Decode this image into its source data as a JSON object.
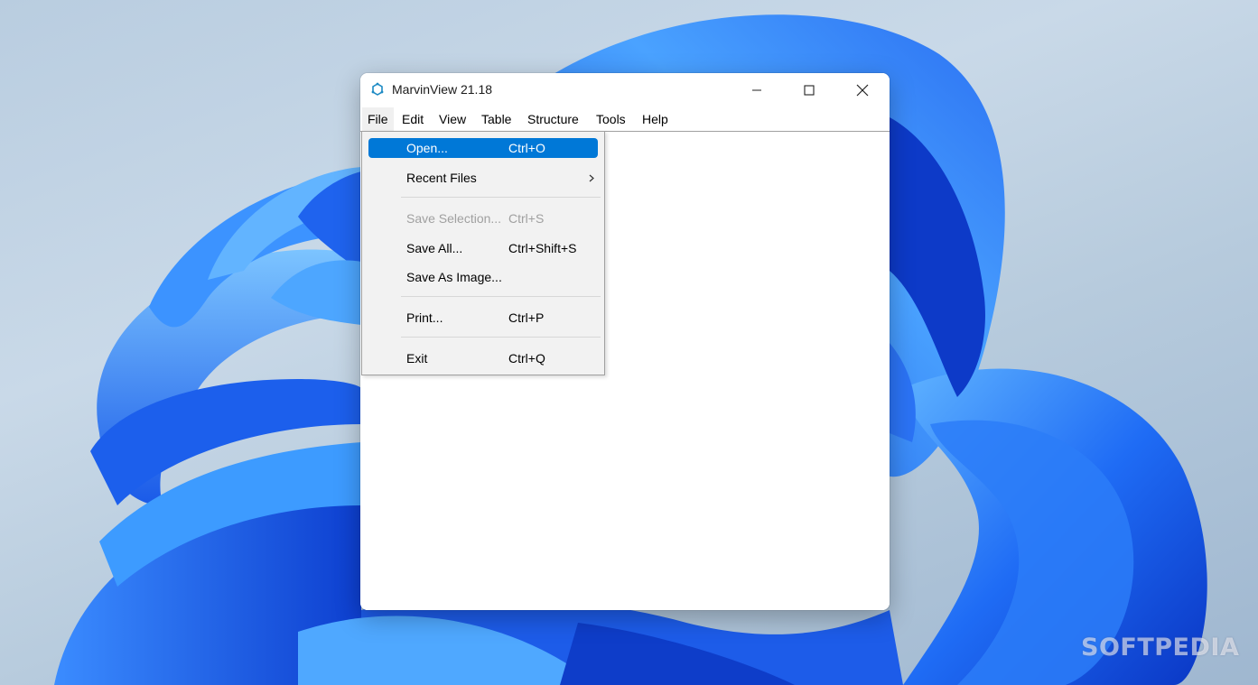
{
  "window": {
    "title": "MarvinView 21.18"
  },
  "menubar": {
    "items": [
      "File",
      "Edit",
      "View",
      "Table",
      "Structure",
      "Tools",
      "Help"
    ]
  },
  "file_menu": {
    "items": [
      {
        "label": "Open...",
        "shortcut": "Ctrl+O",
        "highlighted": true,
        "enabled": true
      },
      {
        "label": "Recent Files",
        "shortcut": "",
        "submenu": true,
        "enabled": true
      },
      {
        "label": "Save Selection...",
        "shortcut": "Ctrl+S",
        "enabled": false
      },
      {
        "label": "Save All...",
        "shortcut": "Ctrl+Shift+S",
        "enabled": true
      },
      {
        "label": "Save As Image...",
        "shortcut": "",
        "enabled": true
      },
      {
        "label": "Print...",
        "shortcut": "Ctrl+P",
        "enabled": true
      },
      {
        "label": "Exit",
        "shortcut": "Ctrl+Q",
        "enabled": true
      }
    ]
  },
  "watermark": "SOFTPEDIA",
  "icons": {
    "app": "marvin-hexagon-icon",
    "minimize": "minimize-icon",
    "maximize": "maximize-icon",
    "close": "close-icon",
    "submenu": "chevron-right-icon"
  },
  "colors": {
    "highlight": "#0078d7",
    "menu_background": "#f2f2f2",
    "disabled_text": "#a0a0a0",
    "wallpaper_blue": "#1a5cf0"
  }
}
